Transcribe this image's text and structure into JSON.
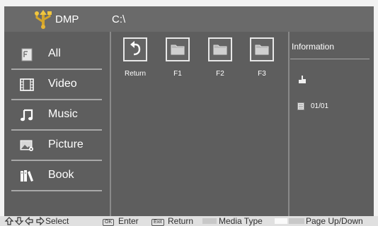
{
  "header": {
    "app_title": "DMP",
    "path": "C:\\"
  },
  "sidebar": {
    "items": [
      {
        "label": "All",
        "icon": "all-files-icon"
      },
      {
        "label": "Video",
        "icon": "film-icon"
      },
      {
        "label": "Music",
        "icon": "music-note-icon"
      },
      {
        "label": "Picture",
        "icon": "picture-icon"
      },
      {
        "label": "Book",
        "icon": "book-icon"
      }
    ]
  },
  "files": [
    {
      "name": "Return",
      "icon": "return-arrow-icon"
    },
    {
      "name": "F1",
      "icon": "folder-icon"
    },
    {
      "name": "F2",
      "icon": "folder-icon"
    },
    {
      "name": "F3",
      "icon": "folder-icon"
    }
  ],
  "info": {
    "title": "Information",
    "page": "01/01"
  },
  "hints": {
    "select": "Select",
    "ok_key": "OK",
    "enter": "Enter",
    "exit_key": "Exit",
    "return": "Return",
    "media_type": "Media Type",
    "page_updown": "Page Up/Down"
  },
  "colors": {
    "frame": "#5e5e5e",
    "topbar": "#6a6a6a",
    "divider": "#8a8a8a"
  }
}
